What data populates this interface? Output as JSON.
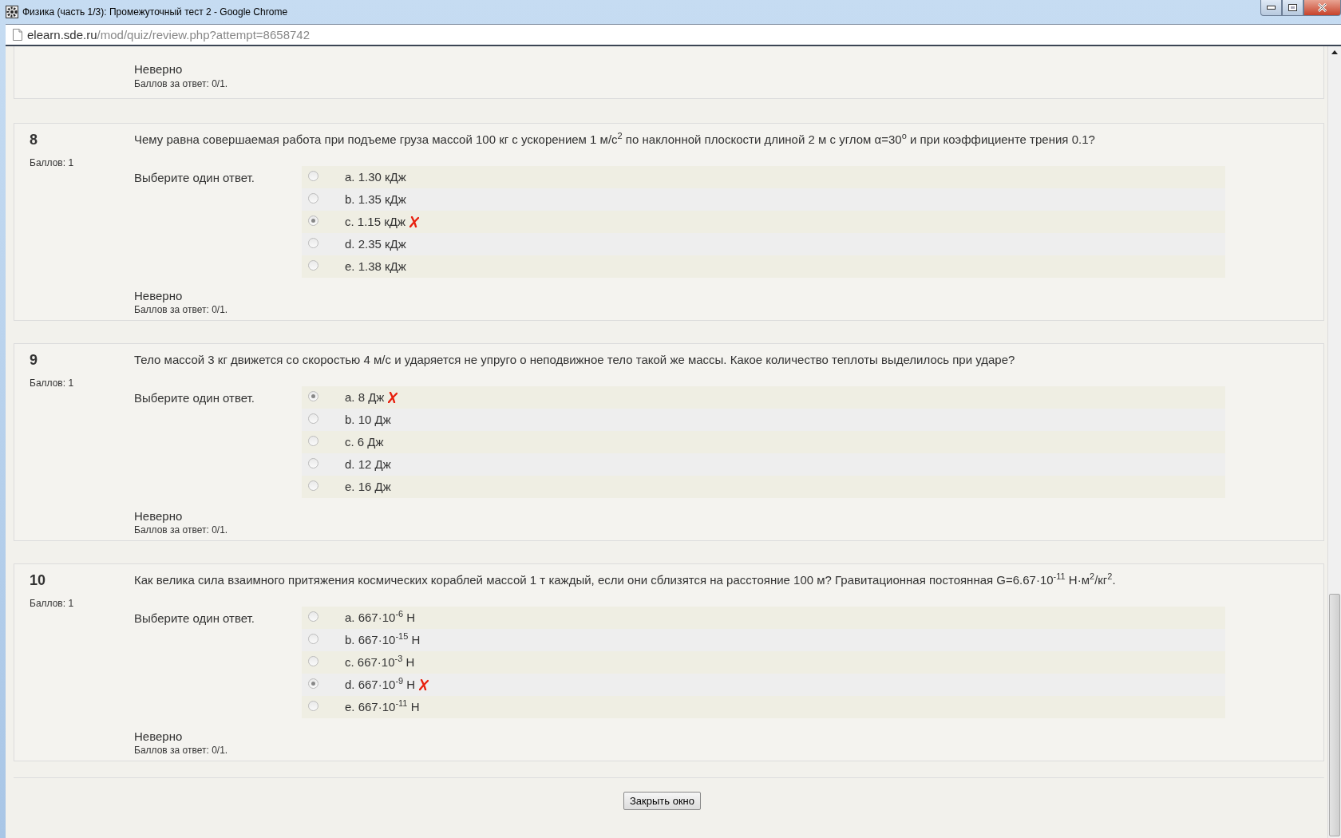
{
  "window": {
    "title": "Физика (часть 1/3): Промежуточный тест 2 - Google Chrome"
  },
  "address_bar": {
    "host": "elearn.sde.ru",
    "path": "/mod/quiz/review.php?attempt=8658742"
  },
  "previous_question": {
    "status": "Неверно",
    "score": "Баллов за ответ: 0/1."
  },
  "questions": [
    {
      "number": "8",
      "points": "Баллов: 1",
      "text": "Чему равна совершаемая работа при подъеме груза массой 100 кг с ускорением 1 м/с$^{2}$ по наклонной плоскости длиной 2 м с углом α=30$^{o}$ и при коэффициенте трения 0.1?",
      "prompt": "Выберите один ответ.",
      "answers": [
        {
          "label": "a. 1.30 кДж",
          "selected": false,
          "marked_wrong": false
        },
        {
          "label": "b. 1.35 кДж",
          "selected": false,
          "marked_wrong": false
        },
        {
          "label": "c. 1.15 кДж",
          "selected": true,
          "marked_wrong": true
        },
        {
          "label": "d. 2.35 кДж",
          "selected": false,
          "marked_wrong": false
        },
        {
          "label": "e. 1.38 кДж",
          "selected": false,
          "marked_wrong": false
        }
      ],
      "status": "Неверно",
      "score": "Баллов за ответ: 0/1."
    },
    {
      "number": "9",
      "points": "Баллов: 1",
      "text": "Тело массой 3 кг движется со скоростью 4 м/с и ударяется не упруго о неподвижное тело такой же массы. Какое количество теплоты выделилось при ударе?",
      "prompt": "Выберите один ответ.",
      "answers": [
        {
          "label": "a. 8 Дж",
          "selected": true,
          "marked_wrong": true
        },
        {
          "label": "b. 10 Дж",
          "selected": false,
          "marked_wrong": false
        },
        {
          "label": "c. 6 Дж",
          "selected": false,
          "marked_wrong": false
        },
        {
          "label": "d. 12 Дж",
          "selected": false,
          "marked_wrong": false
        },
        {
          "label": "e. 16 Дж",
          "selected": false,
          "marked_wrong": false
        }
      ],
      "status": "Неверно",
      "score": "Баллов за ответ: 0/1."
    },
    {
      "number": "10",
      "points": "Баллов: 1",
      "text": "Как велика сила взаимного притяжения космических кораблей массой 1 т каждый, если они сблизятся на расстояние 100 м? Гравитационная постоянная G=6.67·10$^{-11}$ Н·м$^{2}$/кг$^{2}$.",
      "prompt": "Выберите один ответ.",
      "answers": [
        {
          "label": "a. 667·10$^{-6}$ Н",
          "selected": false,
          "marked_wrong": false
        },
        {
          "label": "b. 667·10$^{-15}$ Н",
          "selected": false,
          "marked_wrong": false
        },
        {
          "label": "c. 667·10$^{-3}$ Н",
          "selected": false,
          "marked_wrong": false
        },
        {
          "label": "d. 667·10$^{-9}$ Н",
          "selected": true,
          "marked_wrong": true
        },
        {
          "label": "e. 667·10$^{-11}$ Н",
          "selected": false,
          "marked_wrong": false
        }
      ],
      "status": "Неверно",
      "score": "Баллов за ответ: 0/1."
    }
  ],
  "close_button": "Закрыть окно"
}
